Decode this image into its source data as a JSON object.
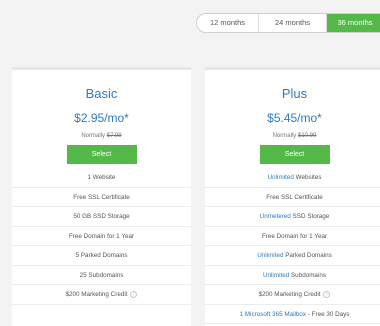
{
  "billing_terms": [
    {
      "label": "12 months",
      "active": false
    },
    {
      "label": "24 months",
      "active": false
    },
    {
      "label": "36 months",
      "active": true
    }
  ],
  "plans": [
    {
      "name": "Basic",
      "price": "$2.95/mo*",
      "normally_label": "Normally",
      "normally_price": "$7.99",
      "select_label": "Select",
      "features": [
        {
          "highlight": "",
          "text": "1 Website"
        },
        {
          "highlight": "",
          "text": "Free SSL Certificate"
        },
        {
          "highlight": "",
          "text": "50 GB SSD Storage"
        },
        {
          "highlight": "",
          "text": "Free Domain for 1 Year"
        },
        {
          "highlight": "",
          "text": "5 Parked Domains"
        },
        {
          "highlight": "",
          "text": "25 Subdomains"
        },
        {
          "highlight": "",
          "text": "$200 Marketing Credit",
          "info": true
        }
      ]
    },
    {
      "name": "Plus",
      "price": "$5.45/mo*",
      "normally_label": "Normally",
      "normally_price": "$10.99",
      "select_label": "Select",
      "features": [
        {
          "highlight": "Unlimited",
          "text": " Websites"
        },
        {
          "highlight": "",
          "text": "Free SSL Certificate"
        },
        {
          "highlight": "Unmetered",
          "text": " SSD Storage"
        },
        {
          "highlight": "",
          "text": "Free Domain for 1 Year"
        },
        {
          "highlight": "Unlimited",
          "text": " Parked Domains"
        },
        {
          "highlight": "Unlimited",
          "text": " Subdomains"
        },
        {
          "highlight": "",
          "text": "$200 Marketing Credit",
          "info": true
        },
        {
          "highlight": "1 Microsoft 365 Mailbox",
          "text": " - Free 30 Days"
        }
      ]
    }
  ],
  "colors": {
    "accent_green": "#54b948",
    "brand_blue": "#2f7bbf"
  },
  "icons": {
    "info": "info-circle-icon",
    "info_glyph": "i"
  }
}
